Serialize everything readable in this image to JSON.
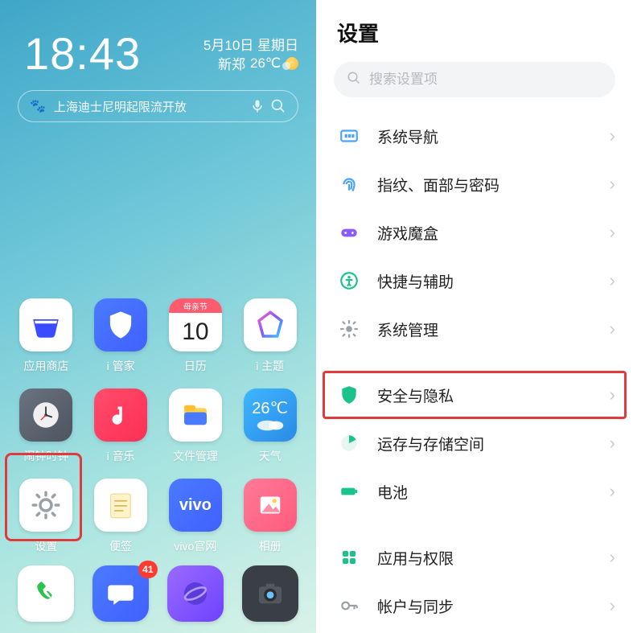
{
  "home": {
    "time": "18:43",
    "date": "5月10日 星期日",
    "location": "新郑",
    "temp": "26℃",
    "news": "上海迪士尼明起限流开放",
    "apps": [
      {
        "id": "app-store",
        "label": "应用商店"
      },
      {
        "id": "i-manager",
        "label": "i 管家"
      },
      {
        "id": "calendar",
        "label": "日历",
        "subtitle": "母亲节",
        "day": "10"
      },
      {
        "id": "i-theme",
        "label": "i 主题"
      },
      {
        "id": "clock",
        "label": "闹钟时钟"
      },
      {
        "id": "i-music",
        "label": "i 音乐"
      },
      {
        "id": "files",
        "label": "文件管理"
      },
      {
        "id": "weather",
        "label": "天气",
        "temp": "26℃"
      },
      {
        "id": "settings",
        "label": "设置"
      },
      {
        "id": "notes",
        "label": "便签"
      },
      {
        "id": "vivo-site",
        "label": "vivo官网"
      },
      {
        "id": "gallery",
        "label": "相册"
      }
    ],
    "dock": [
      {
        "id": "phone"
      },
      {
        "id": "messages",
        "badge": "41"
      },
      {
        "id": "browser"
      },
      {
        "id": "camera"
      }
    ]
  },
  "settings": {
    "title": "设置",
    "search_placeholder": "搜索设置项",
    "items": [
      {
        "id": "nav",
        "label": "系统导航"
      },
      {
        "id": "biometrics",
        "label": "指纹、面部与密码"
      },
      {
        "id": "gamebox",
        "label": "游戏魔盒"
      },
      {
        "id": "shortcut",
        "label": "快捷与辅助"
      },
      {
        "id": "sysmgmt",
        "label": "系统管理"
      },
      {
        "id": "security",
        "label": "安全与隐私",
        "highlighted": true
      },
      {
        "id": "storage",
        "label": "运存与存储空间"
      },
      {
        "id": "battery",
        "label": "电池"
      },
      {
        "id": "apps",
        "label": "应用与权限"
      },
      {
        "id": "account",
        "label": "帐户与同步"
      }
    ]
  }
}
